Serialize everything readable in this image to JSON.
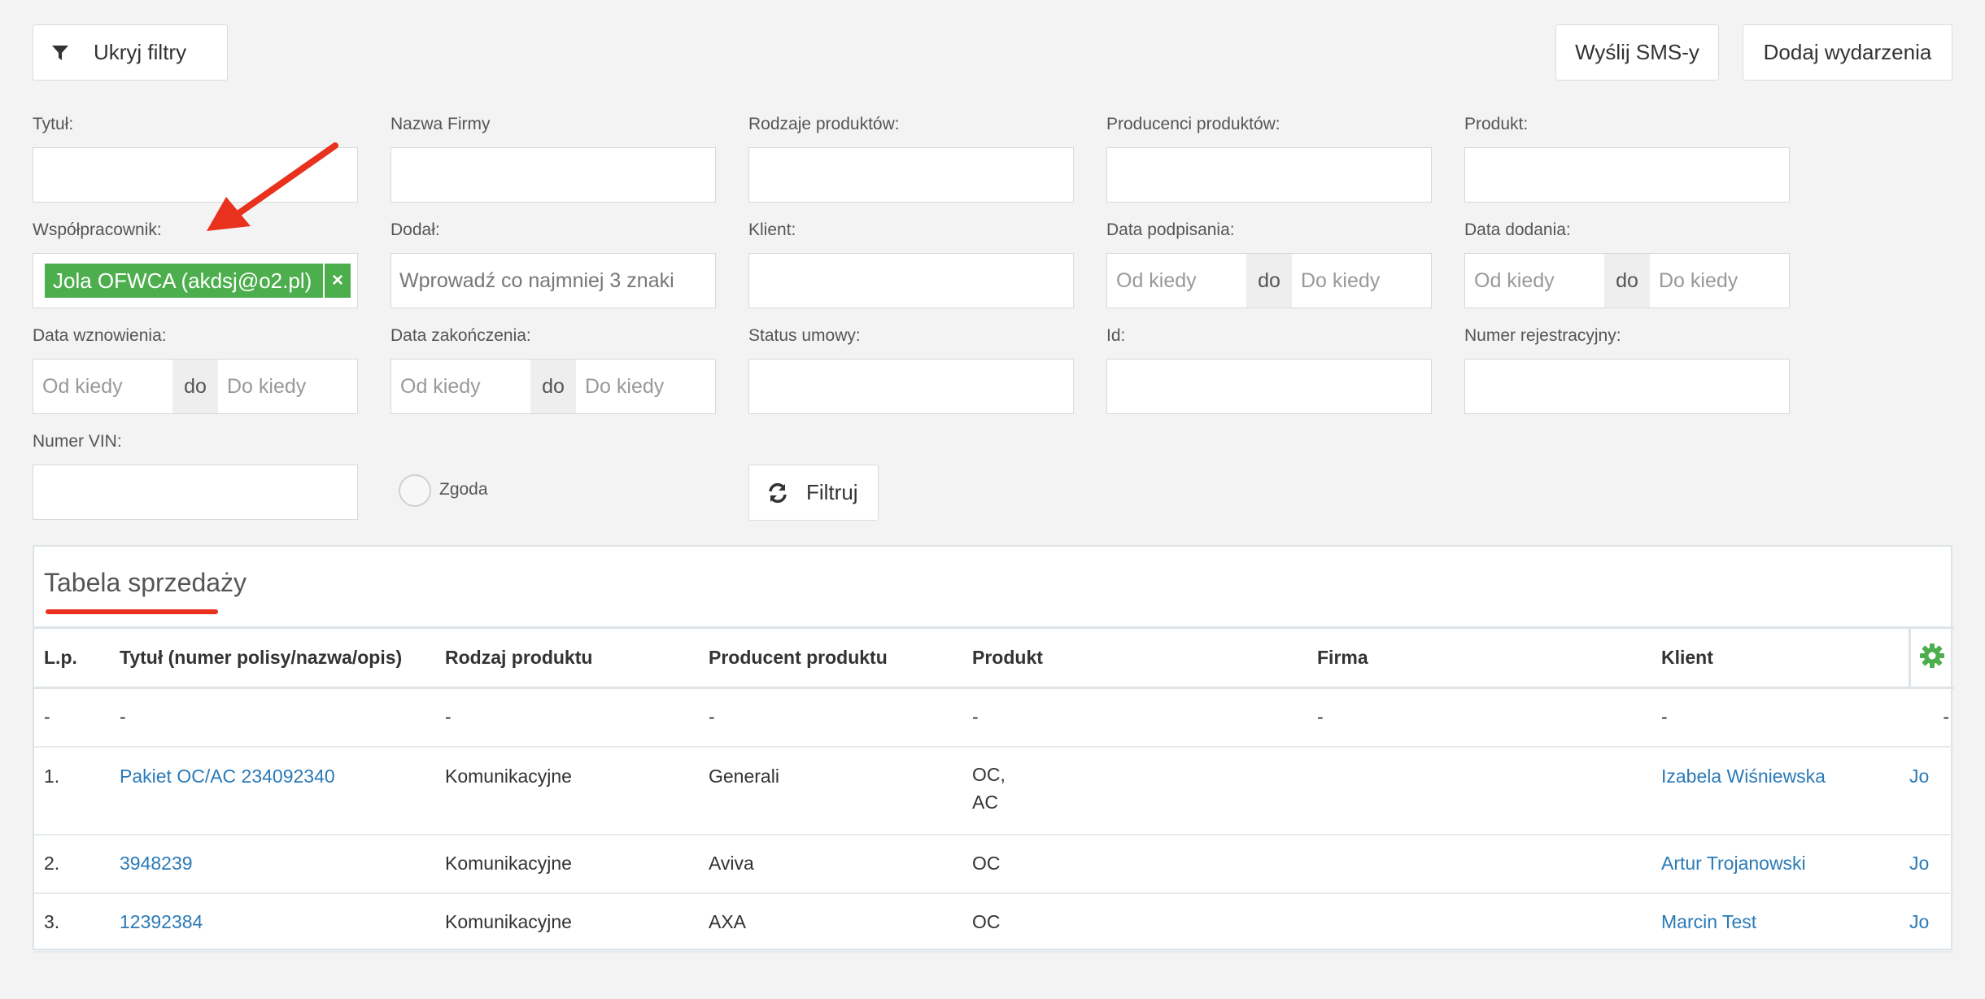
{
  "toolbar": {
    "hide_filters_label": "Ukryj filtry",
    "send_sms_label": "Wyślij SMS-y",
    "add_events_label": "Dodaj wydarzenia"
  },
  "filters": {
    "title_label": "Tytuł:",
    "company_name_label": "Nazwa Firmy",
    "product_types_label": "Rodzaje produktów:",
    "product_producers_label": "Producenci produktów:",
    "product_label": "Produkt:",
    "coworker_label": "Współpracownik:",
    "coworker_tag": "Jola OFWCA (akdsj@o2.pl)",
    "coworker_tag_remove": "×",
    "added_by_label": "Dodał:",
    "added_by_placeholder": "Wprowadź co najmniej 3 znaki",
    "client_label": "Klient:",
    "sign_date_label": "Data podpisania:",
    "added_date_label": "Data dodania:",
    "renewal_date_label": "Data wznowienia:",
    "end_date_label": "Data zakończenia:",
    "contract_status_label": "Status umowy:",
    "id_label": "Id:",
    "reg_number_label": "Numer rejestracyjny:",
    "vin_label": "Numer VIN:",
    "consent_label": "Zgoda",
    "range_from": "Od kiedy",
    "range_sep": "do",
    "range_to": "Do kiedy",
    "filter_button": "Filtruj"
  },
  "table": {
    "title": "Tabela sprzedaży",
    "columns": [
      "L.p.",
      "Tytuł (numer polisy/nazwa/opis)",
      "Rodzaj produktu",
      "Producent produktu",
      "Produkt",
      "Firma",
      "Klient"
    ],
    "filter_row": [
      "-",
      "-",
      "-",
      "-",
      "-",
      "-",
      "-",
      "-"
    ],
    "rows": [
      {
        "lp": "1.",
        "title": "Pakiet OC/AC 234092340",
        "type": "Komunikacyjne",
        "producer": "Generali",
        "product_line1": "OC,",
        "product_line2": "AC",
        "company": "",
        "client": "Izabela Wiśniewska",
        "extra": "Jo"
      },
      {
        "lp": "2.",
        "title": "3948239",
        "type": "Komunikacyjne",
        "producer": "Aviva",
        "product_line1": "OC",
        "product_line2": "",
        "company": "",
        "client": "Artur Trojanowski",
        "extra": "Jo"
      },
      {
        "lp": "3.",
        "title": "12392384",
        "type": "Komunikacyjne",
        "producer": "AXA",
        "product_line1": "OC",
        "product_line2": "",
        "company": "",
        "client": "Marcin Test",
        "extra": "Jo"
      }
    ]
  },
  "colors": {
    "tag_green": "#4cae4c",
    "link_blue": "#2a7ab8",
    "annotation_red": "#e8321e",
    "gear_green": "#4cae4c"
  },
  "icons": [
    "filter-icon",
    "refresh-icon",
    "gear-icon",
    "close-icon"
  ]
}
